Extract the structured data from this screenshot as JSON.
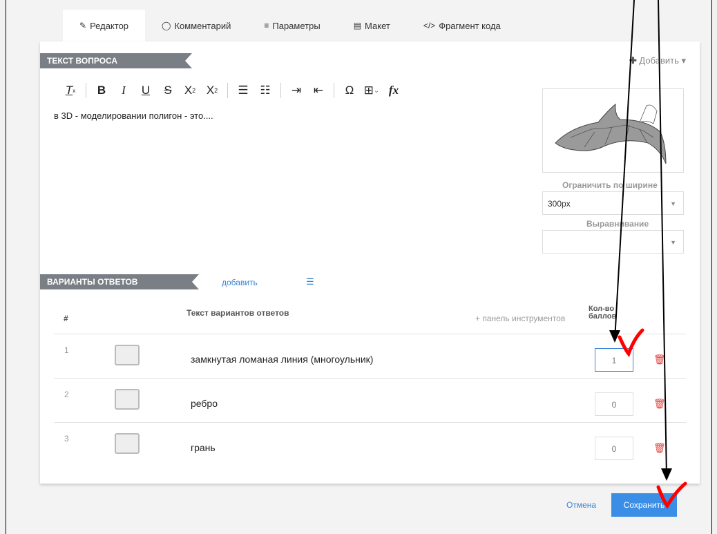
{
  "tabs": [
    {
      "icon": "✎",
      "label": "Редактор"
    },
    {
      "icon": "◯",
      "label": "Комментарий"
    },
    {
      "icon": "≡",
      "label": "Параметры"
    },
    {
      "icon": "▤",
      "label": "Макет"
    },
    {
      "icon": "</>",
      "label": "Фрагмент кода"
    }
  ],
  "question": {
    "section_title": "ТЕКСТ ВОПРОСА",
    "add_label": "Добавить",
    "text": "в 3D - моделировании полигон - это...."
  },
  "image_panel": {
    "width_label": "Ограничить по ширине",
    "width_value": "300px",
    "align_label": "Выравнивание",
    "align_value": ""
  },
  "answers": {
    "section_title": "ВАРИАНТЫ ОТВЕТОВ",
    "add_link": "добавить",
    "col_num": "#",
    "col_text": "Текст вариантов ответов",
    "col_toolbar": "+ панель инструментов",
    "col_score": "Кол-во баллов",
    "rows": [
      {
        "num": "1",
        "text": "замкнутая ломаная линия (многоульник)",
        "score": "1"
      },
      {
        "num": "2",
        "text": "ребро",
        "score": "0"
      },
      {
        "num": "3",
        "text": "грань",
        "score": "0"
      }
    ]
  },
  "footer": {
    "cancel_label": "Отмена",
    "save_label": "Сохранить"
  },
  "colors": {
    "accent": "#3a8ee6",
    "section_label_bg": "#7a7f86",
    "delete": "#e53935",
    "annotation": "#ff0000"
  }
}
